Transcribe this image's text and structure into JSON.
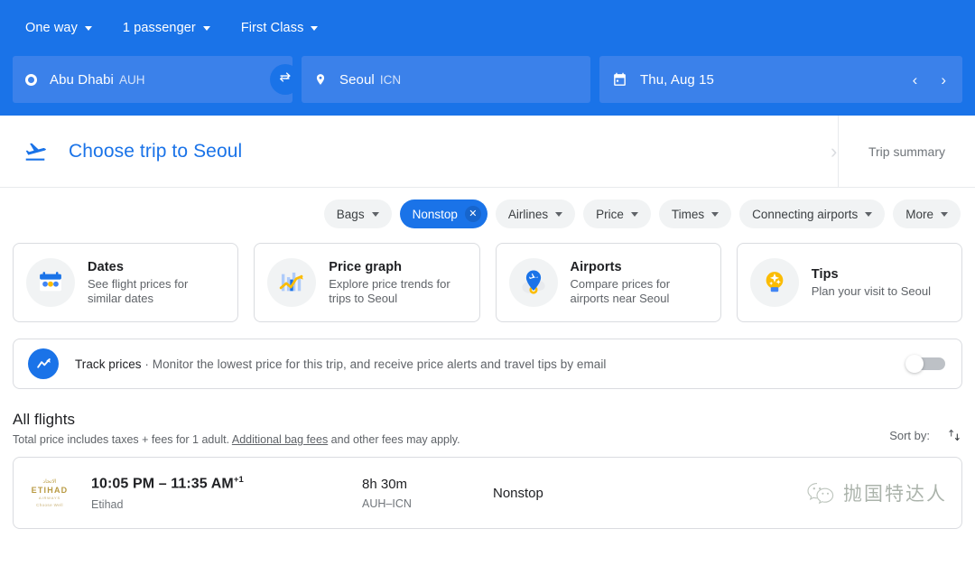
{
  "search": {
    "options": [
      {
        "label": "One way",
        "name": "trip-type-selector"
      },
      {
        "label": "1 passenger",
        "name": "passenger-selector"
      },
      {
        "label": "First Class",
        "name": "cabin-class-selector"
      }
    ],
    "origin": {
      "city": "Abu Dhabi",
      "code": "AUH",
      "icon": "origin-circle-icon"
    },
    "destination": {
      "city": "Seoul",
      "code": "ICN",
      "icon": "destination-pin-icon"
    },
    "swap_icon": "swap-arrows-icon",
    "date": {
      "value": "Thu, Aug 15",
      "icon": "calendar-icon"
    },
    "prev_arrow": "‹",
    "next_arrow": "›",
    "accent_color": "#1a73e8",
    "field_color": "#3b81ea"
  },
  "trip_bar": {
    "title": "Choose trip to Seoul",
    "icon": "flight-takeoff-icon",
    "summary_label": "Trip summary"
  },
  "filters": [
    {
      "label": "Bags",
      "active": false
    },
    {
      "label": "Nonstop",
      "active": true
    },
    {
      "label": "Airlines",
      "active": false
    },
    {
      "label": "Price",
      "active": false
    },
    {
      "label": "Times",
      "active": false
    },
    {
      "label": "Connecting airports",
      "active": false
    },
    {
      "label": "More",
      "active": false
    }
  ],
  "explore_cards": [
    {
      "title": "Dates",
      "subtitle": "See flight prices for similar dates",
      "icon": "calendar-prices-icon"
    },
    {
      "title": "Price graph",
      "subtitle": "Explore price trends for trips to Seoul",
      "icon": "price-graph-icon"
    },
    {
      "title": "Airports",
      "subtitle": "Compare prices for airports near Seoul",
      "icon": "airport-pin-icon"
    },
    {
      "title": "Tips",
      "subtitle": "Plan your visit to Seoul",
      "icon": "lightbulb-icon"
    }
  ],
  "track_prices": {
    "icon": "trending-chart-icon",
    "label": "Track prices",
    "separator": "·",
    "description": "Monitor the lowest price for this trip, and receive price alerts and travel tips by email",
    "toggle_on": false
  },
  "all_flights": {
    "heading": "All flights",
    "note_before": "Total price includes taxes + fees for 1 adult. ",
    "note_link": "Additional bag fees",
    "note_after": " and other fees may apply.",
    "sort_label": "Sort by:",
    "sort_icon": "sort-arrows-icon"
  },
  "flights": [
    {
      "airline_logo": {
        "arabic": "الاتحاد",
        "name": "ETIHAD",
        "sub": "AIRWAYS",
        "sub2": "Choose Well"
      },
      "depart_arrive": "10:05 PM – 11:35 AM",
      "day_offset": "+1",
      "airline": "Etihad",
      "duration": "8h 30m",
      "route": "AUH–ICN",
      "stops": "Nonstop"
    }
  ],
  "watermark": {
    "icon": "wechat-icon",
    "text": "抛国特达人"
  }
}
